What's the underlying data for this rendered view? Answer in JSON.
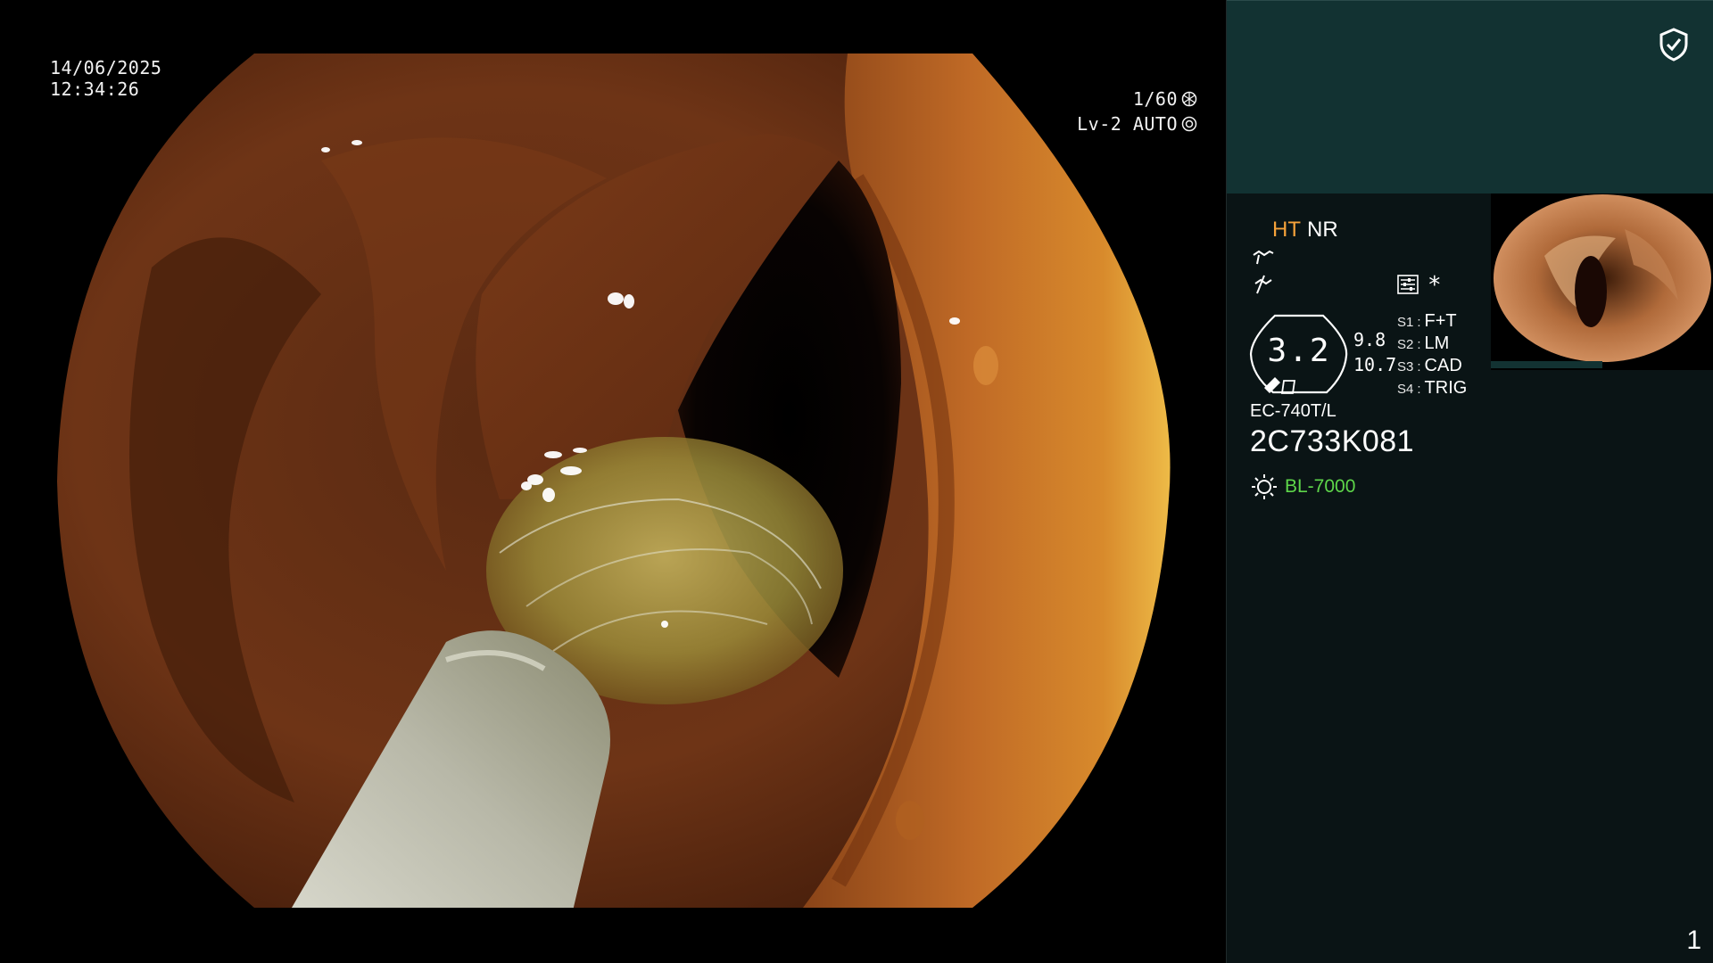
{
  "osd": {
    "date": "14/06/2025",
    "time": "12:34:26",
    "shutter": "1/60",
    "mode": "Lv-2 AUTO"
  },
  "panel": {
    "ht": "HT",
    "nr": "NR",
    "asterisk": "*",
    "gauge_value": "3.2",
    "value_a": "9.8",
    "value_b": "10.7",
    "switches": [
      {
        "key": "S1",
        "value": "F+T"
      },
      {
        "key": "S2",
        "value": "LM"
      },
      {
        "key": "S3",
        "value": "CAD"
      },
      {
        "key": "S4",
        "value": "TRIG"
      }
    ],
    "scope_model": "EC-740T/L",
    "serial": "2C733K081",
    "light_source": "BL-7000",
    "page_number": "1"
  },
  "colors": {
    "accent_orange": "#f5a23a",
    "light_source_green": "#5ed64a",
    "panel_top": "#123232",
    "panel_bg": "#0a1415"
  },
  "icons": [
    "shield-check-icon",
    "tilde-icon",
    "f-slash-icon",
    "settings-icon",
    "gauge-icon",
    "light-bulb-icon",
    "aperture-icon"
  ]
}
